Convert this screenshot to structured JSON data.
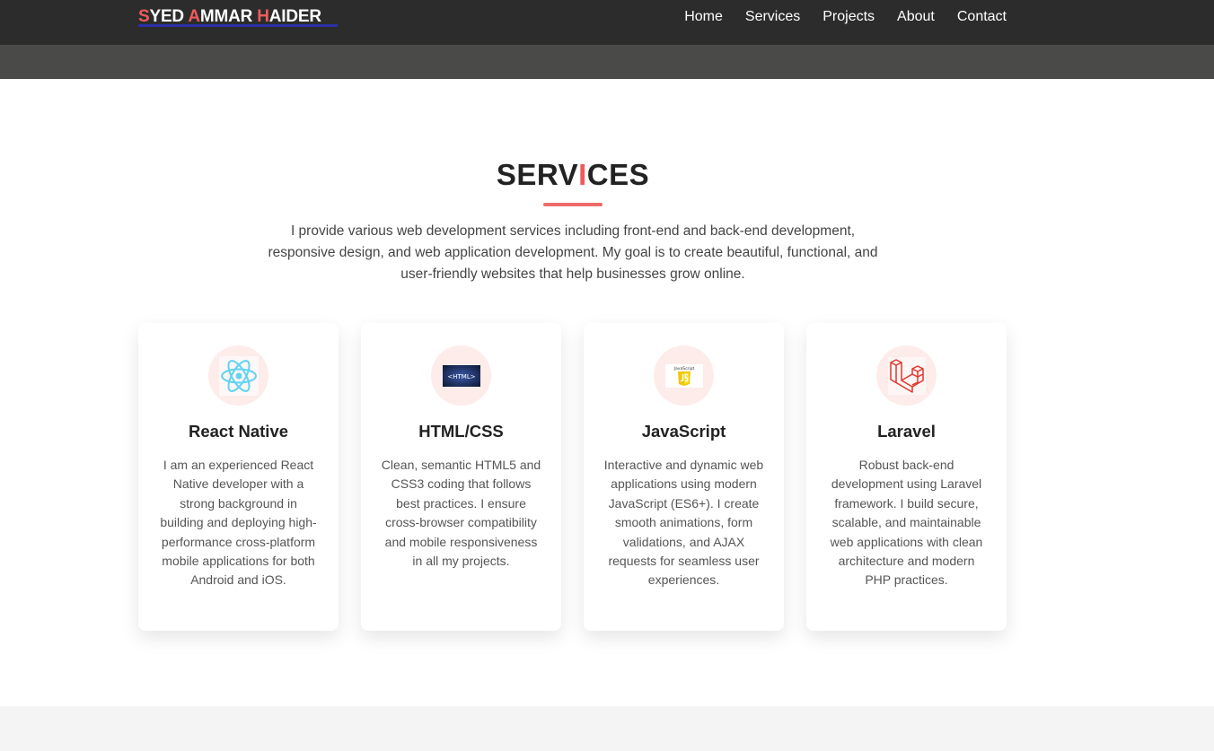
{
  "header": {
    "logo": {
      "first_initial": "S",
      "first_rest": "YED ",
      "second_initial": "A",
      "second_rest": "MMAR ",
      "third_initial": "H",
      "third_rest": "AIDER"
    },
    "nav": [
      "Home",
      "Services",
      "Projects",
      "About",
      "Contact"
    ]
  },
  "colors": {
    "accent": "#ef5b5b",
    "navbar": "#2c2c2c",
    "subbar": "#4a4b49",
    "icon_bg": "#fdecea"
  },
  "services": {
    "title_start": "SERV",
    "title_accent": "I",
    "title_end": "CES",
    "intro": "I provide various web development services including front-end and back-end development, responsive design, and web application development. My goal is to create beautiful, functional, and user-friendly websites that help businesses grow online.",
    "cards": [
      {
        "icon": "react-icon",
        "title": "React Native",
        "text": "I am an experienced React Native developer with a strong background in building and deploying high-performance cross-platform mobile applications for both Android and iOS."
      },
      {
        "icon": "html-icon",
        "icon_text": "<HTML>",
        "title": "HTML/CSS",
        "text": "Clean, semantic HTML5 and CSS3 coding that follows best practices. I ensure cross-browser compatibility and mobile responsiveness in all my projects."
      },
      {
        "icon": "javascript-icon",
        "icon_text": "JavaScript",
        "title": "JavaScript",
        "text": "Interactive and dynamic web applications using modern JavaScript (ES6+). I create smooth animations, form validations, and AJAX requests for seamless user experiences."
      },
      {
        "icon": "laravel-icon",
        "title": "Laravel",
        "text": "Robust back-end development using Laravel framework. I build secure, scalable, and maintainable web applications with clean architecture and modern PHP practices."
      }
    ]
  }
}
